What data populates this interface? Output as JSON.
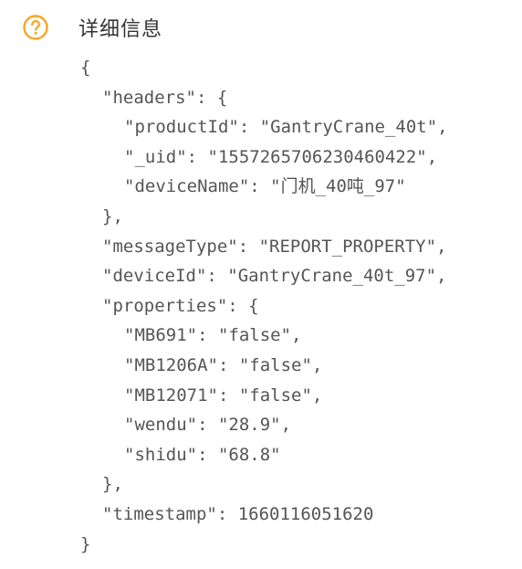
{
  "header": {
    "icon": "question-circle-icon",
    "accent_color": "#f5a623",
    "title": "详细信息"
  },
  "json_viewer": {
    "open_brace": "{",
    "headers_key": "\"headers\": {",
    "product_id": "\"productId\": \"GantryCrane_40t\",",
    "uid": "\"_uid\": \"1557265706230460422\",",
    "device_name": "\"deviceName\": \"门机_40吨_97\"",
    "headers_close": "},",
    "message_type": "\"messageType\": \"REPORT_PROPERTY\",",
    "device_id": "\"deviceId\": \"GantryCrane_40t_97\",",
    "properties_key": "\"properties\": {",
    "mb691": "\"MB691\": \"false\",",
    "mb1206a": "\"MB1206A\": \"false\",",
    "mb12071": "\"MB12071\": \"false\",",
    "wendu": "\"wendu\": \"28.9\",",
    "shidu": "\"shidu\": \"68.8\"",
    "properties_close": "},",
    "timestamp": "\"timestamp\": 1660116051620",
    "close_brace": "}"
  }
}
